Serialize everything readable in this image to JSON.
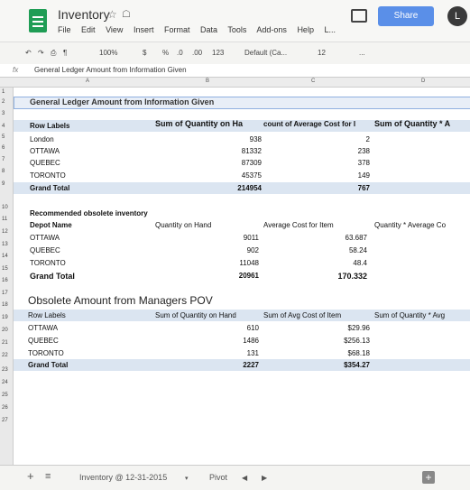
{
  "app": {
    "title": "Inventory",
    "menus": [
      "File",
      "Edit",
      "View",
      "Insert",
      "Format",
      "Data",
      "Tools",
      "Add-ons",
      "Help",
      "L..."
    ],
    "share_label": "Share",
    "avatar_letter": "L"
  },
  "toolbar": {
    "zoom": "100%",
    "currency": "$",
    "percent": "%",
    "dec_less": ".0",
    "dec_more": ".00",
    "format_more": "123",
    "font": "Default (Ca...",
    "font_size": "12",
    "more": "..."
  },
  "formula_bar": {
    "fx": "fx",
    "value": "General Ledger Amount from Information Given"
  },
  "columns": [
    "A",
    "B",
    "C",
    "D"
  ],
  "row_numbers": [
    "1",
    "2",
    "3",
    "4",
    "5",
    "6",
    "7",
    "8",
    "9",
    "10",
    "11",
    "12",
    "13",
    "14",
    "15",
    "16",
    "17",
    "18",
    "19",
    "20",
    "21",
    "22",
    "23",
    "24",
    "25",
    "26",
    "27"
  ],
  "section1": {
    "title": "General Ledger Amount from Information Given",
    "headers": [
      "Row Labels",
      "Sum of Quantity on Ha",
      "count of Average Cost for I",
      "Sum of Quantity * A"
    ],
    "rows": [
      [
        "London",
        "938",
        "2"
      ],
      [
        "OTTAWA",
        "81332",
        "238"
      ],
      [
        "QUEBEC",
        "87309",
        "378"
      ],
      [
        "TORONTO",
        "45375",
        "149"
      ],
      [
        "Grand Total",
        "214954",
        "767"
      ]
    ]
  },
  "section2": {
    "title": "Recommended obsolete inventory",
    "headers": [
      "Depot Name",
      "Quantity on Hand",
      "Average Cost for Item",
      "Quantity * Average Co"
    ],
    "rows": [
      [
        "OTTAWA",
        "9011",
        "63.687"
      ],
      [
        "QUEBEC",
        "902",
        "58.24"
      ],
      [
        "TORONTO",
        "11048",
        "48.4"
      ],
      [
        "Grand Total",
        "20961",
        "170.332"
      ]
    ]
  },
  "section3": {
    "title": "Obsolete Amount from Managers POV",
    "headers": [
      "Row Labels",
      "Sum of Quantity on Hand",
      "Sum of Avg Cost of Item",
      "Sum of Quantity * Avg"
    ],
    "rows": [
      [
        "OTTAWA",
        "610",
        "$29.96"
      ],
      [
        "QUEBEC",
        "1486",
        "$256.13"
      ],
      [
        "TORONTO",
        "131",
        "$68.18"
      ],
      [
        "Grand Total",
        "2227",
        "$354.27"
      ]
    ]
  },
  "tabs": {
    "sheet1": "Inventory @ 12-31-2015",
    "sheet2": "Pivot"
  },
  "colors": {
    "accent": "#5a8fe8",
    "header_band": "#dbe5f1",
    "selected": "#e8eef7"
  }
}
